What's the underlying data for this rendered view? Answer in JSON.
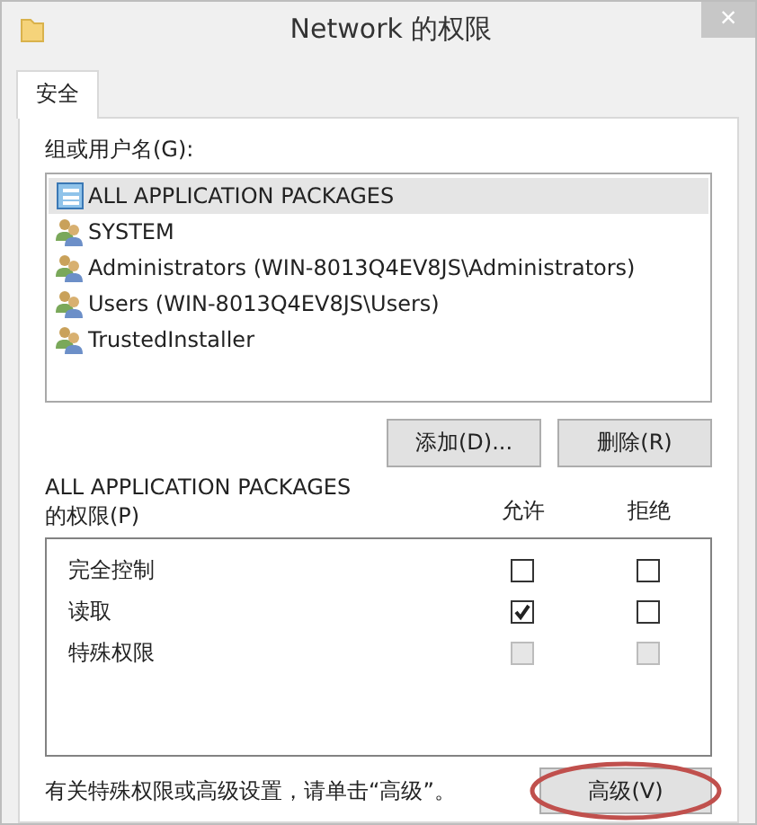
{
  "window": {
    "title": "Network 的权限",
    "close": "×"
  },
  "tabs": [
    {
      "label": "安全",
      "selected": true
    }
  ],
  "groups": {
    "label": "组或用户名(G):",
    "items": [
      {
        "name": "ALL APPLICATION PACKAGES",
        "kind": "package",
        "selected": true
      },
      {
        "name": "SYSTEM",
        "kind": "users",
        "selected": false
      },
      {
        "name": "Administrators (WIN-8013Q4EV8JS\\Administrators)",
        "kind": "users",
        "selected": false
      },
      {
        "name": "Users (WIN-8013Q4EV8JS\\Users)",
        "kind": "users",
        "selected": false
      },
      {
        "name": "TrustedInstaller",
        "kind": "users",
        "selected": false
      }
    ]
  },
  "group_buttons": [
    "添加(D)...",
    "删除(R)"
  ],
  "permissions": {
    "label_line_1": "ALL APPLICATION PACKAGES",
    "label_line_2": "的权限(P)",
    "allow_header": "允许",
    "deny_header": "拒绝",
    "rows": [
      {
        "name": "完全控制",
        "allow": {
          "checked": false,
          "disabled": false
        },
        "deny": {
          "checked": false,
          "disabled": false
        }
      },
      {
        "name": "读取",
        "allow": {
          "checked": true,
          "disabled": false
        },
        "deny": {
          "checked": false,
          "disabled": false
        }
      },
      {
        "name": "特殊权限",
        "allow": {
          "checked": false,
          "disabled": true
        },
        "deny": {
          "checked": false,
          "disabled": true
        }
      }
    ]
  },
  "advanced": {
    "note": "有关特殊权限或高级设置，请单击“高级”。",
    "button": "高级(V)",
    "circled": true
  }
}
